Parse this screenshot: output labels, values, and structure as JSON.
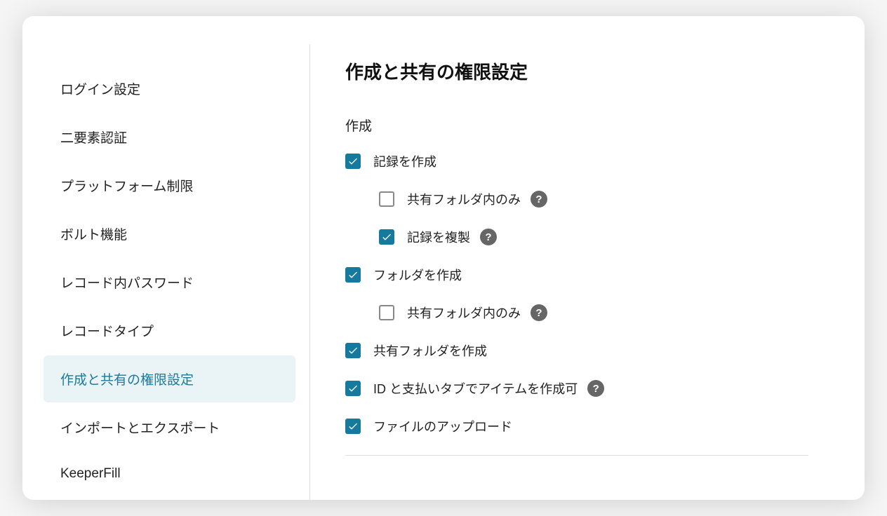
{
  "sidebar": {
    "items": [
      {
        "label": "ログイン設定",
        "active": false
      },
      {
        "label": "二要素認証",
        "active": false
      },
      {
        "label": "プラットフォーム制限",
        "active": false
      },
      {
        "label": "ボルト機能",
        "active": false
      },
      {
        "label": "レコード内パスワード",
        "active": false
      },
      {
        "label": "レコードタイプ",
        "active": false
      },
      {
        "label": "作成と共有の権限設定",
        "active": true
      },
      {
        "label": "インポートとエクスポート",
        "active": false
      },
      {
        "label": "KeeperFill",
        "active": false
      }
    ]
  },
  "main": {
    "title": "作成と共有の権限設定",
    "section_label": "作成",
    "options": {
      "create_record": {
        "label": "記録を作成",
        "checked": true
      },
      "shared_folder_only_1": {
        "label": "共有フォルダ内のみ",
        "checked": false
      },
      "duplicate_record": {
        "label": "記録を複製",
        "checked": true
      },
      "create_folder": {
        "label": "フォルダを作成",
        "checked": true
      },
      "shared_folder_only_2": {
        "label": "共有フォルダ内のみ",
        "checked": false
      },
      "create_shared_folder": {
        "label": "共有フォルダを作成",
        "checked": true
      },
      "create_id_payment": {
        "label": "ID と支払いタブでアイテムを作成可",
        "checked": true
      },
      "file_upload": {
        "label": "ファイルのアップロード",
        "checked": true
      }
    }
  },
  "help_glyph": "?"
}
